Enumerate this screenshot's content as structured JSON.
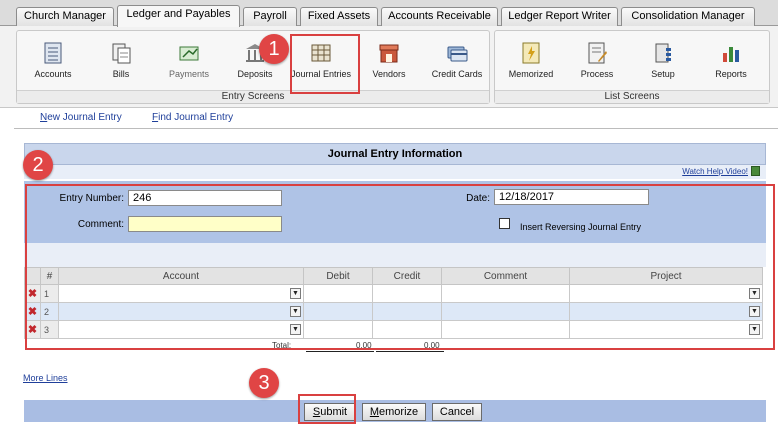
{
  "tabs": [
    {
      "label": "Church Manager",
      "active": false
    },
    {
      "label": "Ledger and Payables",
      "active": true
    },
    {
      "label": "Payroll",
      "active": false
    },
    {
      "label": "Fixed Assets",
      "active": false
    },
    {
      "label": "Accounts Receivable",
      "active": false
    },
    {
      "label": "Ledger Report Writer",
      "active": false
    },
    {
      "label": "Consolidation Manager",
      "active": false
    }
  ],
  "ribbon": {
    "entry_group_label": "Entry Screens",
    "list_group_label": "List Screens",
    "entry_buttons": [
      {
        "label": "Accounts",
        "icon": "accounts-icon"
      },
      {
        "label": "Bills",
        "icon": "bills-icon"
      },
      {
        "label": "Payments",
        "icon": "payments-icon"
      },
      {
        "label": "Deposits",
        "icon": "deposits-icon"
      },
      {
        "label": "Journal Entries",
        "icon": "journal-entries-icon"
      },
      {
        "label": "Vendors",
        "icon": "vendors-icon"
      },
      {
        "label": "Credit Cards",
        "icon": "credit-cards-icon"
      }
    ],
    "list_buttons": [
      {
        "label": "Memorized",
        "icon": "memorized-icon"
      },
      {
        "label": "Process",
        "icon": "process-icon"
      },
      {
        "label": "Setup",
        "icon": "setup-icon"
      },
      {
        "label": "Reports",
        "icon": "reports-icon"
      }
    ]
  },
  "links": {
    "new_journal_entry": {
      "first": "N",
      "rest": "ew Journal Entry"
    },
    "find_journal_entry": {
      "first": "F",
      "rest": "ind Journal Entry"
    }
  },
  "panel": {
    "title": "Journal Entry Information",
    "help_link": "Watch Help Video!"
  },
  "form": {
    "entry_number_label": "Entry Number:",
    "entry_number_value": "246",
    "comment_label": "Comment:",
    "comment_value": "",
    "date_label": "Date:",
    "date_value": "12/18/2017",
    "reversing_label": "Insert Reversing Journal Entry",
    "reversing_checked": false
  },
  "grid": {
    "columns": [
      "#",
      "Account",
      "Debit",
      "Credit",
      "Comment",
      "Project"
    ],
    "rows": [
      {
        "num": "1",
        "account": "",
        "debit": "",
        "credit": "",
        "comment": "",
        "project": ""
      },
      {
        "num": "2",
        "account": "",
        "debit": "",
        "credit": "",
        "comment": "",
        "project": ""
      },
      {
        "num": "3",
        "account": "",
        "debit": "",
        "credit": "",
        "comment": "",
        "project": ""
      }
    ],
    "delete_glyph": "✖",
    "dropdown_glyph": "▼"
  },
  "totals": {
    "label": "Total:",
    "debit": "0.00",
    "credit": "0.00"
  },
  "more_lines": "More Lines",
  "actions": {
    "submit": {
      "first": "S",
      "rest": "ubmit"
    },
    "memorize": {
      "first": "M",
      "rest": "emorize"
    },
    "cancel": "Cancel"
  },
  "callouts": [
    "1",
    "2",
    "3"
  ],
  "colors": {
    "callout": "#e04545",
    "highlight": "#d94040",
    "form_bg": "#afc3e6",
    "link": "#1f3f9a"
  }
}
